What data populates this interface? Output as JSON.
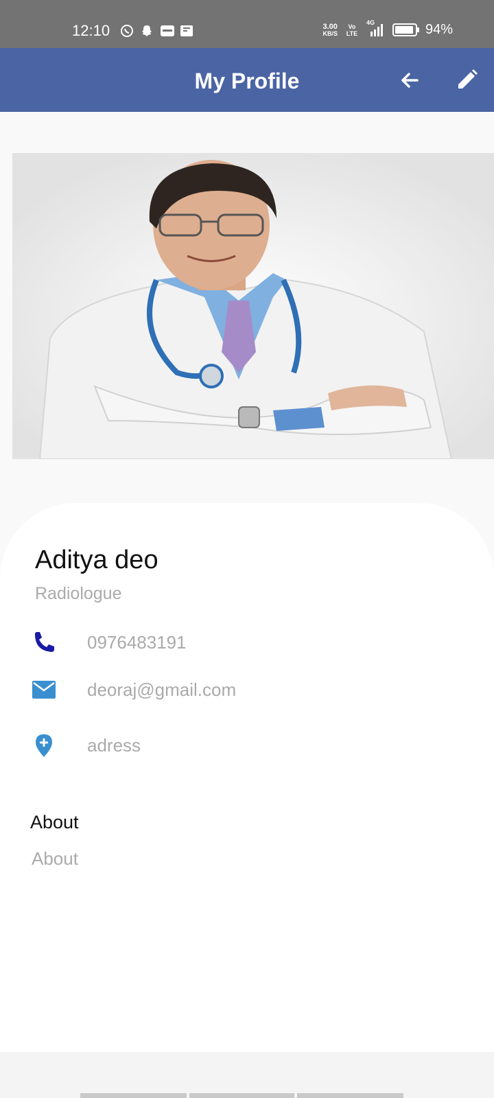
{
  "status_bar": {
    "time": "12:10",
    "net_speed_value": "3.00",
    "net_speed_unit": "KB/S",
    "volte": "Vo LTE",
    "network": "4G",
    "battery": "94%",
    "battery_level": 0.94,
    "notification_icons": [
      "whatsapp-icon",
      "snapchat-icon",
      "app-notification-icon",
      "message-notification-icon"
    ]
  },
  "app_bar": {
    "title": "My Profile",
    "color": "#4a64a4"
  },
  "profile": {
    "name": "Aditya deo",
    "specialty": "Radiologue",
    "phone": "0976483191",
    "email": "deoraj@gmail.com",
    "address": "adress",
    "about_heading": "About",
    "about_text": "About"
  },
  "colors": {
    "phone_icon": "#1a1aa6",
    "email_icon": "#3a8fd0",
    "location_icon": "#3a8fd0",
    "muted_text": "#aaaaaa"
  }
}
